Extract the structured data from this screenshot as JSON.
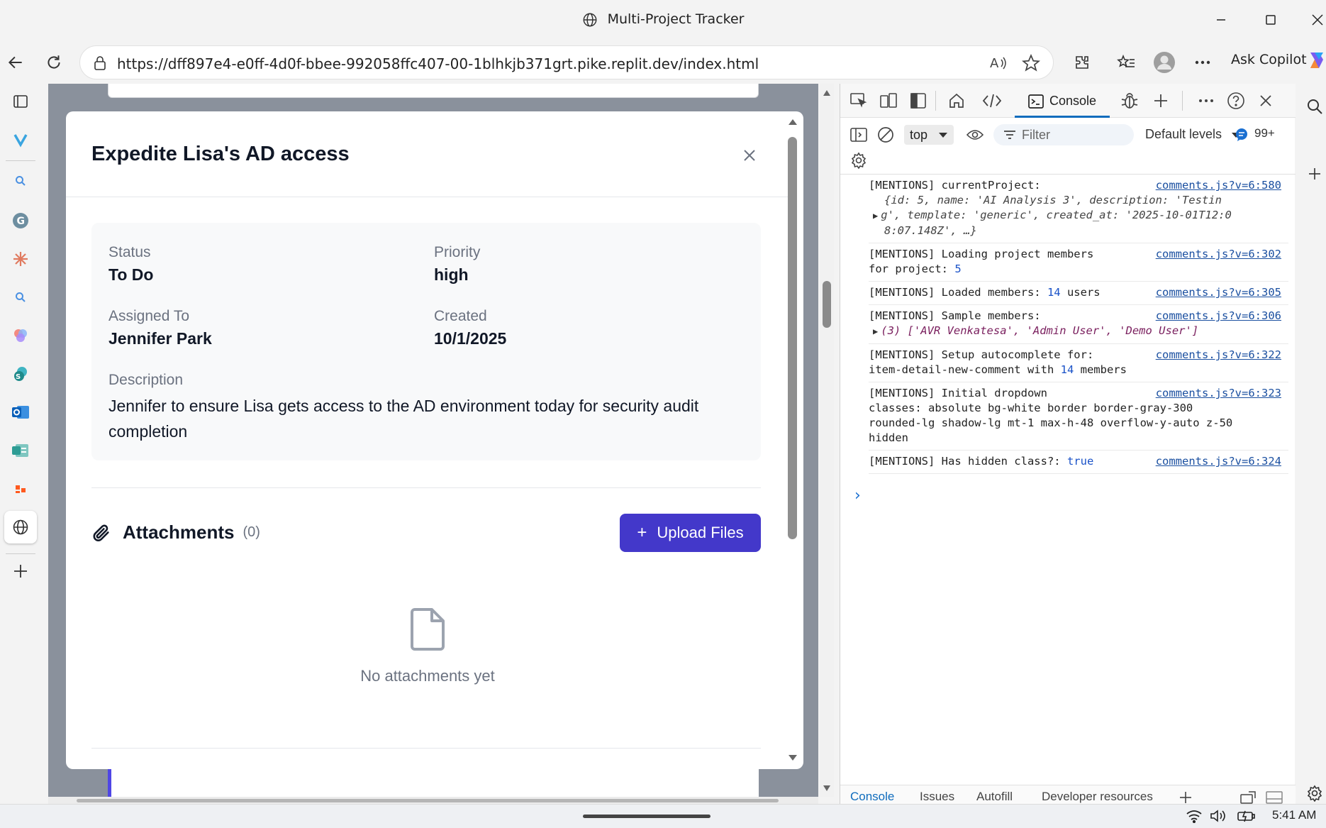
{
  "window": {
    "title": "Multi-Project Tracker"
  },
  "browser": {
    "url": "https://dff897e4-e0ff-4d0f-bbee-992058ffc407-00-1blhkjb371grt.pike.replit.dev/index.html",
    "copilot_label": "Ask Copilot"
  },
  "modal": {
    "title": "Expedite Lisa's AD access",
    "status_label": "Status",
    "status_value": "To Do",
    "priority_label": "Priority",
    "priority_value": "high",
    "assigned_label": "Assigned To",
    "assigned_value": "Jennifer Park",
    "created_label": "Created",
    "created_value": "10/1/2025",
    "description_label": "Description",
    "description_value": "Jennifer to ensure Lisa gets access to the AD environment today for security audit completion",
    "attachments_title": "Attachments",
    "attachments_count": "(0)",
    "upload_label": "Upload Files",
    "empty_text": "No attachments yet"
  },
  "devtools": {
    "active_tab": "Console",
    "context": "top",
    "filter_placeholder": "Filter",
    "levels": "Default levels",
    "message_count": "99+",
    "bottom_tabs": [
      "Console",
      "Issues",
      "Autofill",
      "Developer resources"
    ],
    "logs": [
      {
        "text": "[MENTIONS] currentProject:",
        "src": "comments.js?v=6:580",
        "obj": "{id: 5, name: 'AI Analysis 3', description: 'Testin",
        "obj2": "g', template: 'generic', created_at: '2025-10-01T12:0",
        "obj3": "8:07.148Z', …}"
      },
      {
        "text": "[MENTIONS] Loading project members",
        "text2": "for project: ",
        "num": "5",
        "src": "comments.js?v=6:302"
      },
      {
        "text": "[MENTIONS] Loaded members: ",
        "num": "14",
        "text_after": " users",
        "src": "comments.js?v=6:305"
      },
      {
        "text": "[MENTIONS] Sample members:",
        "arr": "(3) ['AVR Venkatesa', 'Admin User', 'Demo User']",
        "src": "comments.js?v=6:306"
      },
      {
        "text": "[MENTIONS] Setup autocomplete for:",
        "text2": "item-detail-new-comment with ",
        "num": "14",
        "text_after": " members",
        "src": "comments.js?v=6:322"
      },
      {
        "text": "[MENTIONS] Initial dropdown",
        "text2": "classes: absolute bg-white border border-gray-300",
        "text3": "rounded-lg shadow-lg mt-1 max-h-48 overflow-y-auto z-50",
        "text4": "hidden",
        "src": "comments.js?v=6:323"
      },
      {
        "text": "[MENTIONS] Has hidden class?: ",
        "num": "true",
        "src": "comments.js?v=6:324"
      }
    ]
  },
  "taskbar": {
    "time": "5:41 AM"
  },
  "colors": {
    "accent": "#4338ca",
    "overlay": "#8a919c",
    "link": "#1a4fa0"
  }
}
